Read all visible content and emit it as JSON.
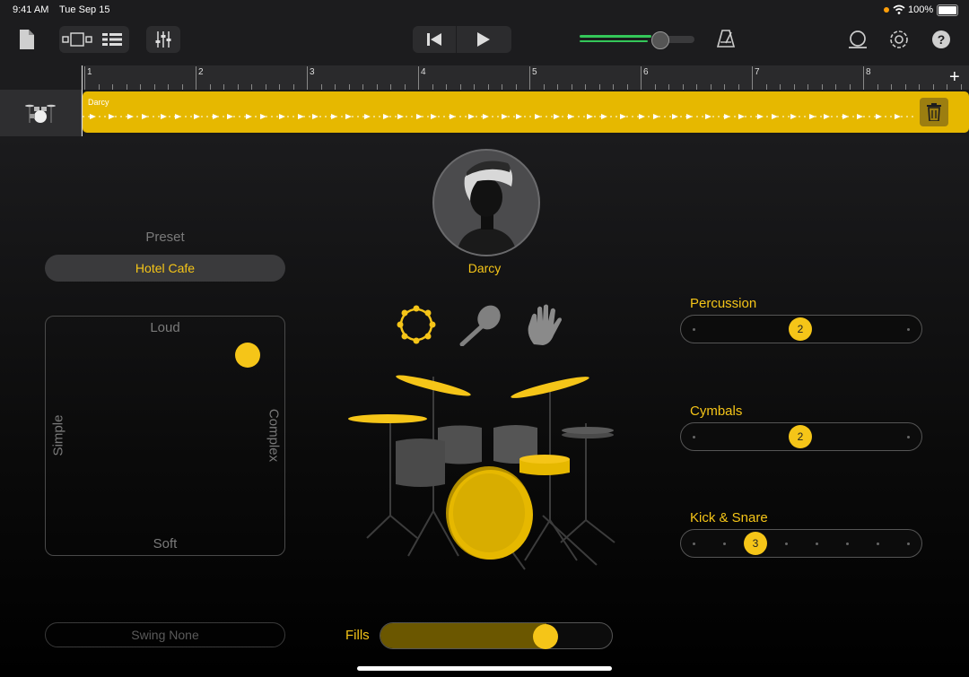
{
  "status": {
    "time": "9:41 AM",
    "date": "Tue Sep 15",
    "battery": "100%"
  },
  "toolbar": {
    "icons": [
      "document-icon",
      "view-toggle-icon",
      "tracks-view-icon",
      "mixer-icon",
      "rewind-icon",
      "play-icon",
      "metronome-icon",
      "loop-icon",
      "settings-icon",
      "help-icon"
    ],
    "volume_level": 0.7,
    "accent": "#f5c518",
    "meter_color": "#34c759"
  },
  "ruler": {
    "bars": [
      "1",
      "2",
      "3",
      "4",
      "5",
      "6",
      "7",
      "8"
    ],
    "add_label": "+"
  },
  "track": {
    "region_label": "Darcy",
    "region_color": "#e6b800"
  },
  "drummer": {
    "name": "Darcy"
  },
  "preset": {
    "heading": "Preset",
    "value": "Hotel Cafe"
  },
  "pad": {
    "top": "Loud",
    "bottom": "Soft",
    "left": "Simple",
    "right": "Complex",
    "puck": {
      "complexity": 0.84,
      "loudness": 0.84
    }
  },
  "instruments": [
    "tambourine-icon",
    "shaker-icon",
    "clap-icon"
  ],
  "sliders": [
    {
      "label": "Percussion",
      "value": "2"
    },
    {
      "label": "Cymbals",
      "value": "2"
    },
    {
      "label": "Kick & Snare",
      "value": "3"
    }
  ],
  "swing": {
    "label": "Swing None"
  },
  "fills": {
    "label": "Fills",
    "level": 0.71
  }
}
